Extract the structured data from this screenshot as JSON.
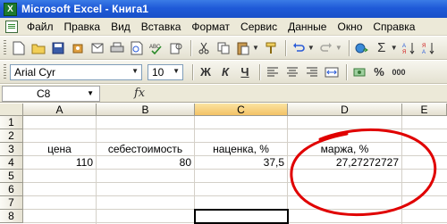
{
  "window": {
    "title": "Microsoft Excel - Книга1",
    "logo_letter": "X"
  },
  "menu": [
    {
      "label": "Файл"
    },
    {
      "label": "Правка"
    },
    {
      "label": "Вид"
    },
    {
      "label": "Вставка"
    },
    {
      "label": "Формат"
    },
    {
      "label": "Сервис"
    },
    {
      "label": "Данные"
    },
    {
      "label": "Окно"
    },
    {
      "label": "Справка"
    }
  ],
  "toolbar": {
    "font_name": "Arial Cyr",
    "font_size": "10",
    "bold_label": "Ж",
    "italic_label": "К",
    "underline_label": "Ч",
    "sum_label": "Σ"
  },
  "formula_bar": {
    "name_box": "C8",
    "fx_label": "fx"
  },
  "sheet": {
    "columns": [
      "A",
      "B",
      "C",
      "D",
      "E"
    ],
    "active_column": "C",
    "rows": [
      "1",
      "2",
      "3",
      "4",
      "5",
      "6",
      "7",
      "8"
    ],
    "row3": {
      "A": "цена",
      "B": "себестоимость",
      "C": "наценка, %",
      "D": "маржа, %"
    },
    "row4": {
      "A": "110",
      "B": "80",
      "C": "37,5",
      "D": "27,27272727"
    },
    "annotation_color": "#e00000",
    "selection_color": "#000000"
  }
}
